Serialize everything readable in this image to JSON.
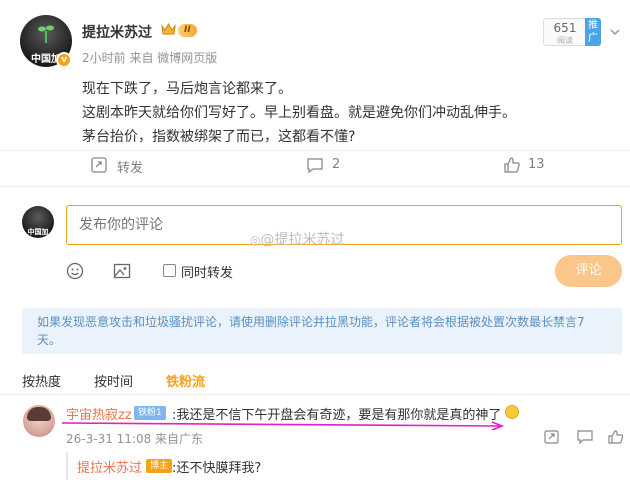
{
  "post": {
    "author": "提拉米苏过",
    "avatar_text": "中国加",
    "vip_level": "II",
    "meta": "2小时前  来自 微博网页版",
    "read_count": "651",
    "read_label": "阅读",
    "promote_label": "推广",
    "lines": [
      "现在下跌了，马后炮言论都来了。",
      "这剧本昨天就给你们写好了。早上别看盘。就是避免你们冲动乱伸手。",
      "茅台抬价，指数被绑架了而已，这都看不懂?"
    ],
    "repost_label": "转发",
    "comment_count": "2",
    "like_count": "13"
  },
  "composer": {
    "avatar_text": "中国加",
    "placeholder": "发布你的评论",
    "watermark": "@提拉米苏过",
    "also_repost_label": "同时转发",
    "submit_label": "评论"
  },
  "notice": "如果发现恶意攻击和垃圾骚扰评论，请使用删除评论并拉黑功能，评论者将会根据被处置次数最长禁言7天。",
  "tabs": [
    "按热度",
    "按时间",
    "铁粉流"
  ],
  "comment": {
    "author": "宇宙热寂zz",
    "badge": "铁粉1",
    "text": ":我还是不信下午开盘会有奇迹，要是有那你就是真的神了",
    "time": "26-3-31 11:08 来自广东"
  },
  "reply": {
    "author": "提拉米苏过",
    "badge": "博主",
    "text": ":还不快膜拜我?"
  },
  "colors": {
    "accent": "#f7a21b",
    "name": "#eb7350",
    "notice_bg": "#eaf3fb",
    "notice_text": "#5a8fc2",
    "annotation": "#e020c8"
  }
}
